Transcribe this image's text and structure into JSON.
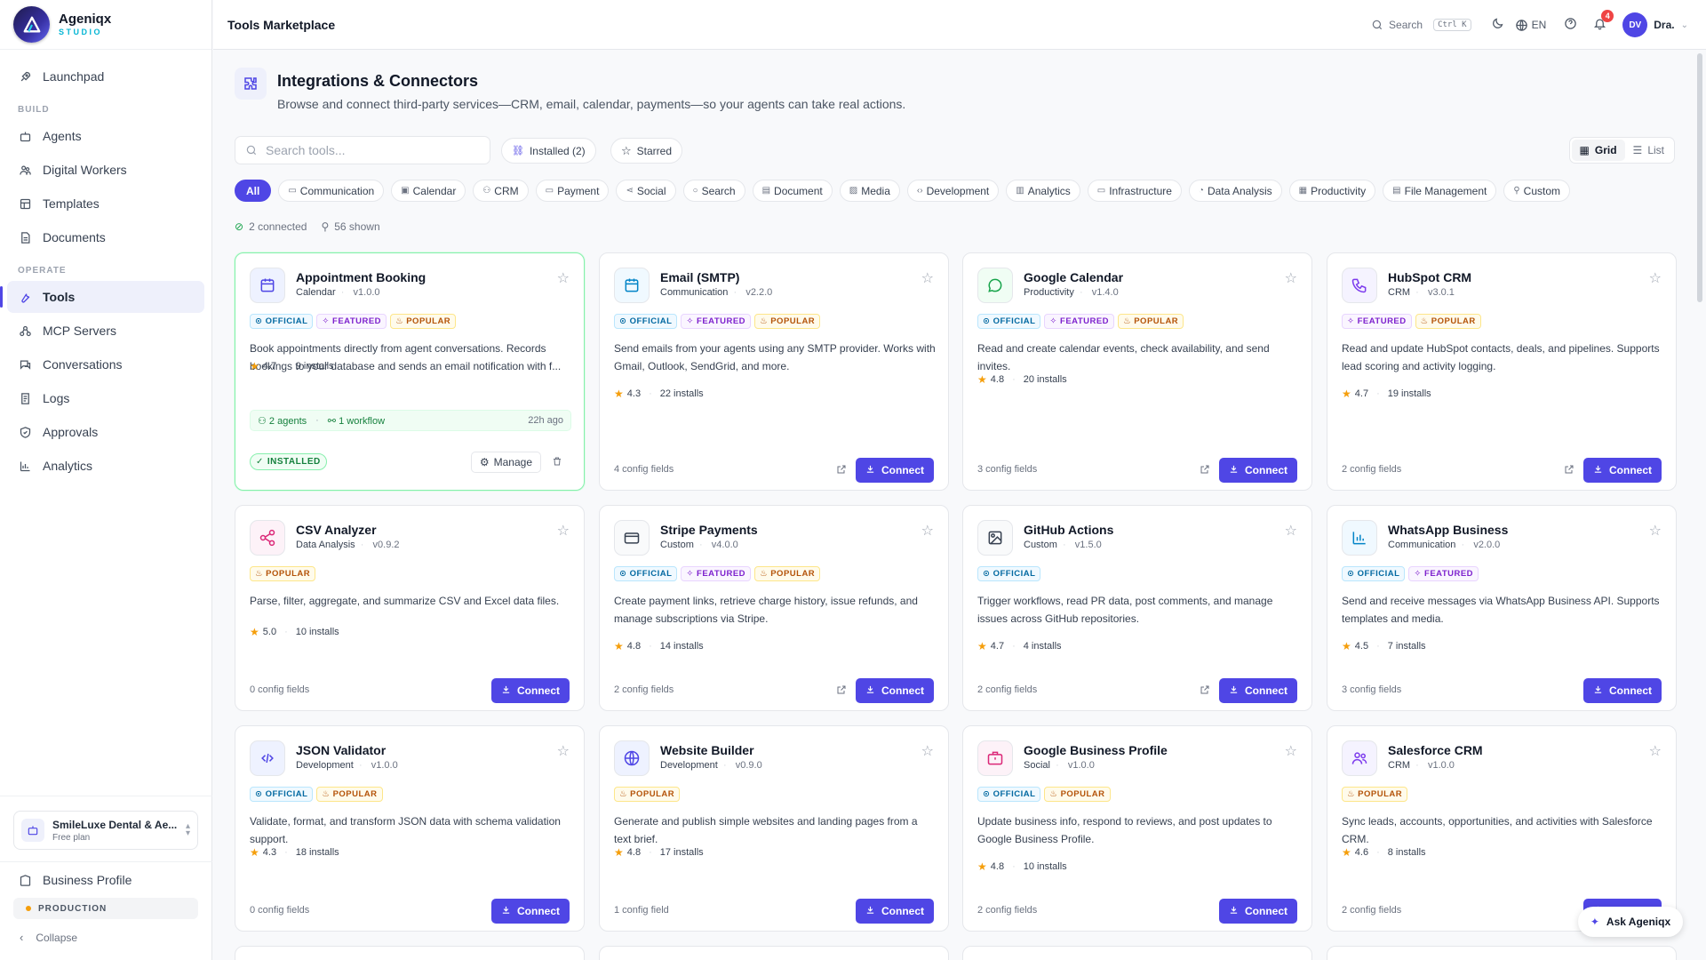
{
  "brand": {
    "name": "Ageniqx",
    "sub": "STUDIO"
  },
  "sidebar": {
    "launchpad": "Launchpad",
    "build_label": "BUILD",
    "build": [
      "Agents",
      "Digital Workers",
      "Templates",
      "Documents"
    ],
    "operate_label": "OPERATE",
    "operate": [
      "Tools",
      "MCP Servers",
      "Conversations",
      "Logs",
      "Approvals",
      "Analytics"
    ],
    "workspace_name": "SmileLuxe Dental & Ae...",
    "workspace_plan": "Free plan",
    "business_profile": "Business Profile",
    "env": "PRODUCTION",
    "collapse": "Collapse"
  },
  "topbar": {
    "title": "Tools Marketplace",
    "search": "Search",
    "shortcut": "Ctrl K",
    "lang": "EN",
    "notif_count": "4",
    "avatar": "DV",
    "user": "Dra."
  },
  "header": {
    "title": "Integrations & Connectors",
    "desc": "Browse and connect third-party services—CRM, email, calendar, payments—so your agents can take real actions."
  },
  "toolbar": {
    "search_placeholder": "Search tools...",
    "installed": "Installed (2)",
    "starred": "Starred",
    "grid": "Grid",
    "list": "List"
  },
  "categories": [
    "All",
    "Communication",
    "Calendar",
    "CRM",
    "Payment",
    "Social",
    "Search",
    "Document",
    "Media",
    "Development",
    "Analytics",
    "Infrastructure",
    "Data Analysis",
    "Productivity",
    "File Management",
    "Custom"
  ],
  "stats": {
    "connected": "2 connected",
    "shown": "56 shown"
  },
  "labels": {
    "connect": "Connect",
    "manage": "Manage",
    "installed": "INSTALLED",
    "official": "OFFICIAL",
    "featured": "FEATURED",
    "popular": "POPULAR",
    "ask": "Ask Ageniqx"
  },
  "tools": [
    {
      "name": "Appointment Booking",
      "category": "Calendar",
      "version": "v1.0.0",
      "badges": [
        "official",
        "featured",
        "popular"
      ],
      "desc": "Book appointments directly from agent conversations. Records bookings to your database and sends an email notification with f...",
      "rating": "4.7",
      "installs": "9 installs",
      "installed": true,
      "agents": "2 agents",
      "workflow": "1 workflow",
      "ago": "22h ago",
      "icon": "calendar-icon",
      "color": "#4f46e5",
      "bg": "#eef2ff"
    },
    {
      "name": "Email (SMTP)",
      "category": "Communication",
      "version": "v2.2.0",
      "badges": [
        "official",
        "featured",
        "popular"
      ],
      "desc": "Send emails from your agents using any SMTP provider. Works with Gmail, Outlook, SendGrid, and more.",
      "rating": "4.3",
      "installs": "22 installs",
      "config": "4 config fields",
      "ext": true,
      "icon": "calendar-icon",
      "color": "#0284c7",
      "bg": "#f0f9ff"
    },
    {
      "name": "Google Calendar",
      "category": "Productivity",
      "version": "v1.4.0",
      "badges": [
        "official",
        "featured",
        "popular"
      ],
      "desc": "Read and create calendar events, check availability, and send invites.",
      "rating": "4.8",
      "installs": "20 installs",
      "config": "3 config fields",
      "ext": true,
      "icon": "chat-icon",
      "color": "#16a34a",
      "bg": "#f0fdf4"
    },
    {
      "name": "HubSpot CRM",
      "category": "CRM",
      "version": "v3.0.1",
      "badges": [
        "featured",
        "popular"
      ],
      "desc": "Read and update HubSpot contacts, deals, and pipelines. Supports lead scoring and activity logging.",
      "rating": "4.7",
      "installs": "19 installs",
      "config": "2 config fields",
      "ext": true,
      "icon": "phone-icon",
      "color": "#7c3aed",
      "bg": "#f5f3ff"
    },
    {
      "name": "CSV Analyzer",
      "category": "Data Analysis",
      "version": "v0.9.2",
      "badges": [
        "popular"
      ],
      "desc": "Parse, filter, aggregate, and summarize CSV and Excel data files.",
      "rating": "5.0",
      "installs": "10 installs",
      "config": "0 config fields",
      "ext": false,
      "icon": "share-icon",
      "color": "#db2777",
      "bg": "#fdf2f8"
    },
    {
      "name": "Stripe Payments",
      "category": "Custom",
      "version": "v4.0.0",
      "badges": [
        "official",
        "featured",
        "popular"
      ],
      "desc": "Create payment links, retrieve charge history, issue refunds, and manage subscriptions via Stripe.",
      "rating": "4.8",
      "installs": "14 installs",
      "config": "2 config fields",
      "ext": true,
      "icon": "card-icon",
      "color": "#374151",
      "bg": "#f9fafb"
    },
    {
      "name": "GitHub Actions",
      "category": "Custom",
      "version": "v1.5.0",
      "badges": [
        "official"
      ],
      "desc": "Trigger workflows, read PR data, post comments, and manage issues across GitHub repositories.",
      "rating": "4.7",
      "installs": "4 installs",
      "config": "2 config fields",
      "ext": true,
      "icon": "image-icon",
      "color": "#374151",
      "bg": "#f9fafb"
    },
    {
      "name": "WhatsApp Business",
      "category": "Communication",
      "version": "v2.0.0",
      "badges": [
        "official",
        "featured"
      ],
      "desc": "Send and receive messages via WhatsApp Business API. Supports templates and media.",
      "rating": "4.5",
      "installs": "7 installs",
      "config": "3 config fields",
      "ext": false,
      "icon": "bar-chart-icon",
      "color": "#0284c7",
      "bg": "#f0f9ff"
    },
    {
      "name": "JSON Validator",
      "category": "Development",
      "version": "v1.0.0",
      "badges": [
        "official",
        "popular"
      ],
      "desc": "Validate, format, and transform JSON data with schema validation support.",
      "rating": "4.3",
      "installs": "18 installs",
      "config": "0 config fields",
      "ext": false,
      "icon": "code-icon",
      "color": "#4f46e5",
      "bg": "#eef2ff"
    },
    {
      "name": "Website Builder",
      "category": "Development",
      "version": "v0.9.0",
      "badges": [
        "popular"
      ],
      "desc": "Generate and publish simple websites and landing pages from a text brief.",
      "rating": "4.8",
      "installs": "17 installs",
      "config": "1 config field",
      "ext": false,
      "icon": "globe-icon",
      "color": "#4f46e5",
      "bg": "#eef2ff"
    },
    {
      "name": "Google Business Profile",
      "category": "Social",
      "version": "v1.0.0",
      "badges": [
        "official",
        "popular"
      ],
      "desc": "Update business info, respond to reviews, and post updates to Google Business Profile.",
      "rating": "4.8",
      "installs": "10 installs",
      "config": "2 config fields",
      "ext": false,
      "icon": "briefcase-icon",
      "color": "#db2777",
      "bg": "#fdf2f8"
    },
    {
      "name": "Salesforce CRM",
      "category": "CRM",
      "version": "v1.0.0",
      "badges": [
        "popular"
      ],
      "desc": "Sync leads, accounts, opportunities, and activities with Salesforce CRM.",
      "rating": "4.6",
      "installs": "8 installs",
      "config": "2 config fields",
      "ext": false,
      "icon": "users-icon",
      "color": "#7c3aed",
      "bg": "#f5f3ff"
    }
  ]
}
